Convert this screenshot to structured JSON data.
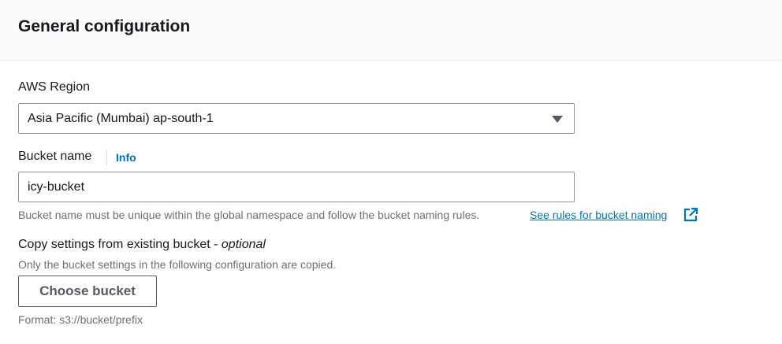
{
  "panel": {
    "title": "General configuration"
  },
  "region": {
    "label": "AWS Region",
    "selected": "Asia Pacific (Mumbai) ap-south-1"
  },
  "bucket_name": {
    "label": "Bucket name",
    "info_link": "Info",
    "value": "icy-bucket",
    "hint": "Bucket name must be unique within the global namespace and follow the bucket naming rules.",
    "rules_link": "See rules for bucket naming"
  },
  "copy_settings": {
    "label": "Copy settings from existing bucket - ",
    "label_optional": "optional",
    "description": "Only the bucket settings in the following configuration are copied.",
    "button_label": "Choose bucket",
    "format_hint": "Format: s3://bucket/prefix"
  },
  "icons": {
    "region_dropdown": "caret-down-icon",
    "rules_link": "external-link-icon"
  },
  "colors": {
    "link": "#0073bb",
    "text": "#16191f",
    "secondary_text": "#687078",
    "header_bg": "#fafafa"
  }
}
